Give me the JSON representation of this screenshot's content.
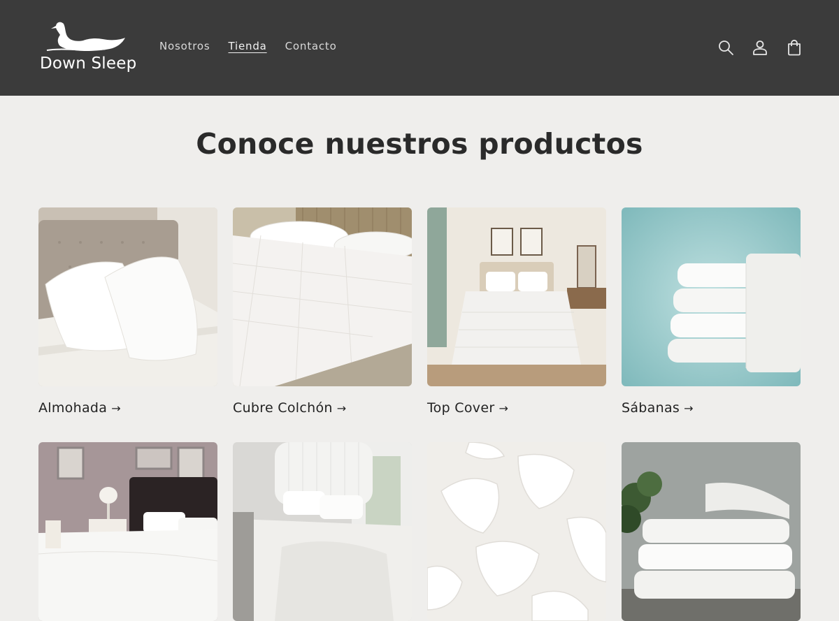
{
  "brand": {
    "name": "Down Sleep"
  },
  "nav": {
    "items": [
      {
        "label": "Nosotros",
        "active": false
      },
      {
        "label": "Tienda",
        "active": true
      },
      {
        "label": "Contacto",
        "active": false
      }
    ]
  },
  "header_icons": [
    "search-icon",
    "account-icon",
    "cart-icon"
  ],
  "section": {
    "title": "Conoce nuestros productos"
  },
  "products": [
    {
      "title": "Almohada",
      "arrow": "→",
      "image": "pillows-on-bed"
    },
    {
      "title": "Cubre Colchón",
      "arrow": "→",
      "image": "mattress-topper"
    },
    {
      "title": "Top Cover",
      "arrow": "→",
      "image": "bedroom-white-bedding"
    },
    {
      "title": "Sábanas",
      "arrow": "→",
      "image": "folded-sheets"
    },
    {
      "title": "",
      "image": "dark-headboard-bedroom"
    },
    {
      "title": "",
      "image": "white-bed-linen"
    },
    {
      "title": "",
      "image": "scattered-pillows"
    },
    {
      "title": "",
      "image": "stacked-towels"
    }
  ],
  "colors": {
    "header_bg": "#3b3b3b",
    "page_bg": "#efeeec",
    "text": "#222222"
  }
}
